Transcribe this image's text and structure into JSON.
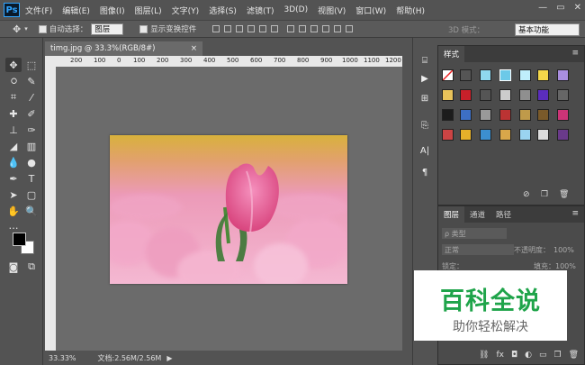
{
  "app": {
    "logo": "Ps"
  },
  "menu": [
    "文件(F)",
    "编辑(E)",
    "图像(I)",
    "图层(L)",
    "文字(Y)",
    "选择(S)",
    "滤镜(T)",
    "3D(D)",
    "视图(V)",
    "窗口(W)",
    "帮助(H)"
  ],
  "window_controls": [
    "—",
    "▭",
    "✕"
  ],
  "options": {
    "auto_select_label": "自动选择：",
    "auto_select_value": "图层",
    "show_transform_label": "显示变换控件",
    "mode_3d": "3D 模式：",
    "workspace": "基本功能"
  },
  "document": {
    "tab_title": "timg.jpg @ 33.3%(RGB/8#)",
    "close": "×",
    "zoom": "33.33%",
    "doc_size": "文档:2.56M/2.56M"
  },
  "ruler_ticks": [
    "200",
    "100",
    "0",
    "100",
    "200",
    "300",
    "400",
    "500",
    "600",
    "700",
    "800",
    "900",
    "1000",
    "1100",
    "1200"
  ],
  "styles_panel": {
    "tab": "样式"
  },
  "layers_panel": {
    "tabs": [
      "图层",
      "通道",
      "路径"
    ],
    "filter_label": "ρ 类型",
    "blend_mode": "正常",
    "opacity_label": "不透明度：",
    "opacity_value": "100%",
    "lock_label": "锁定：",
    "fill_label": "填充：",
    "fill_value": "100%"
  },
  "watermark": {
    "title": "百科全说",
    "subtitle": "助你轻松解决"
  },
  "colors": {
    "accent_blue": "#2fa4ff",
    "watermark_green": "#1fa44a",
    "ui_dark": "#535353"
  }
}
